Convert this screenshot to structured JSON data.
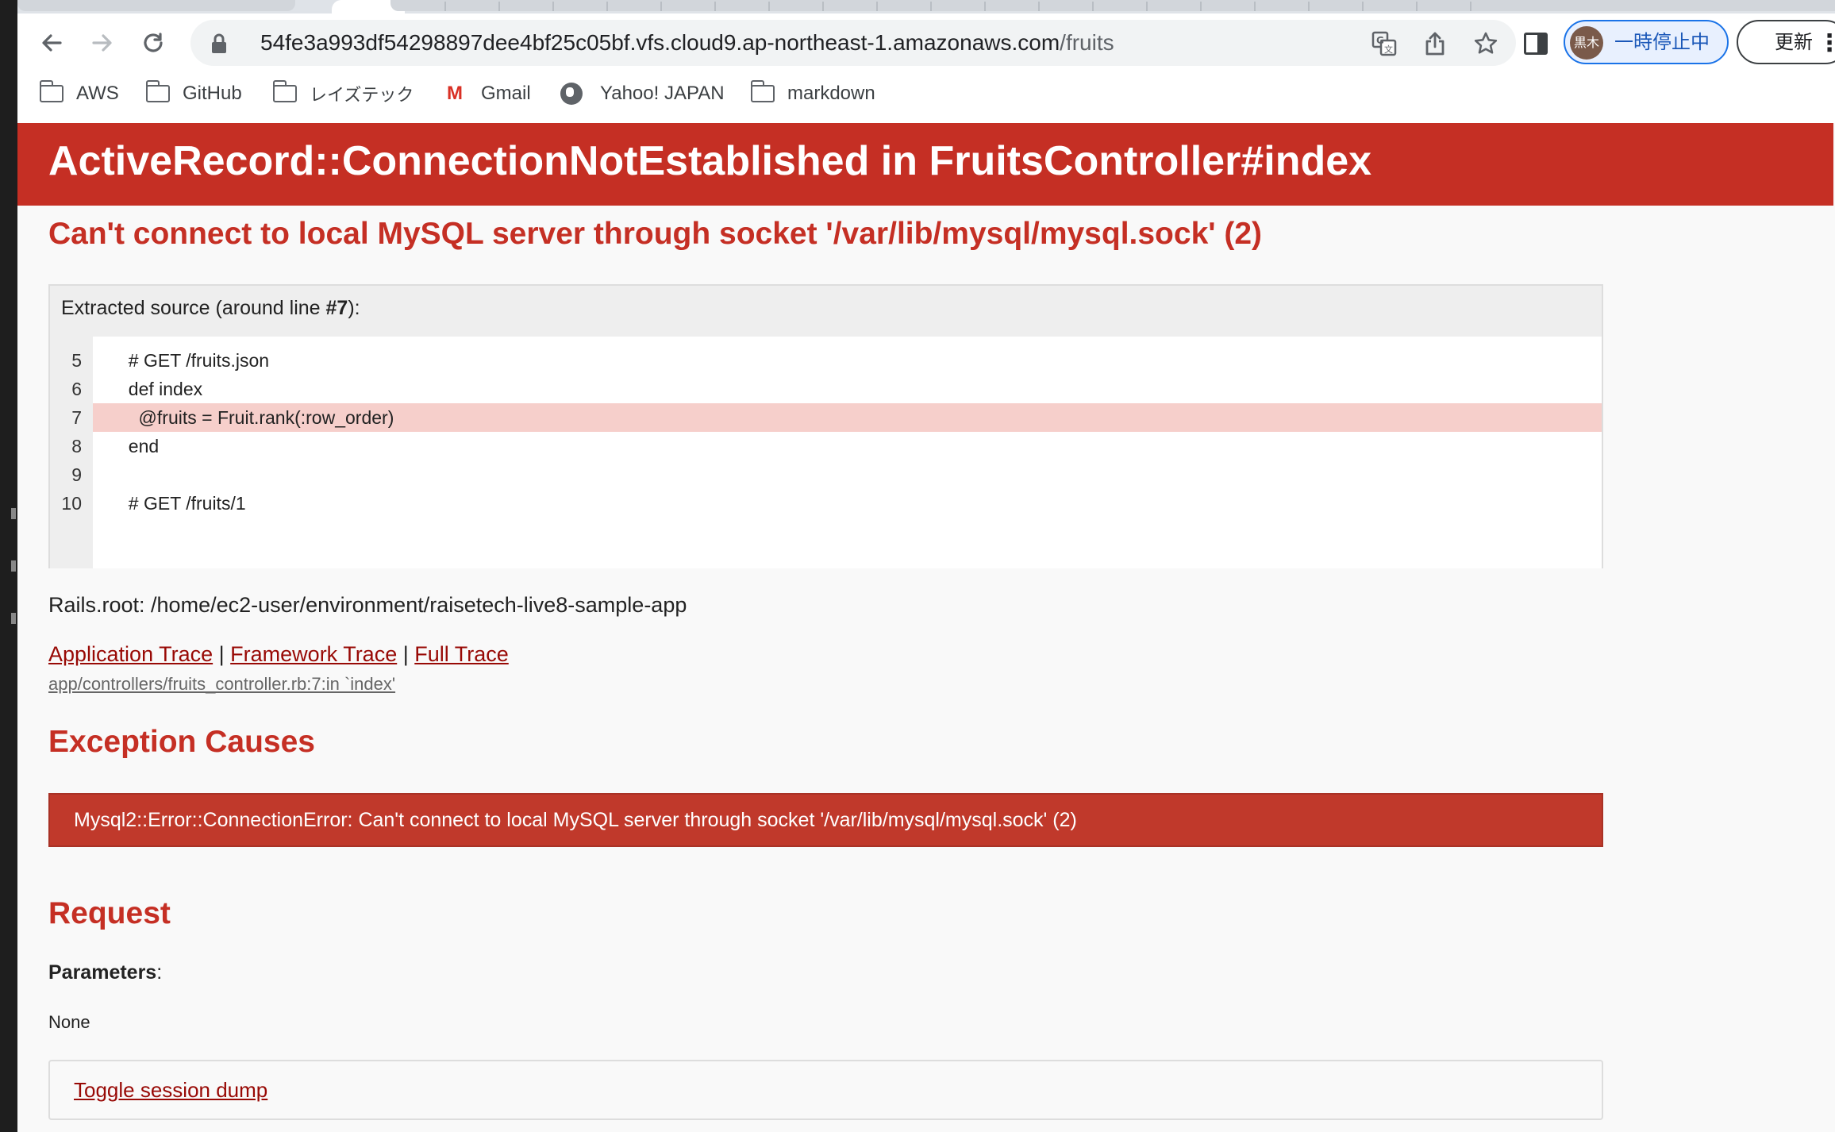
{
  "browser": {
    "url_host": "54fe3a993df54298897dee4bf25c05bf.vfs.cloud9.ap-northeast-1.amazonaws.com",
    "url_path": "/fruits",
    "profile_avatar_text": "黒木",
    "profile_status": "一時停止中",
    "update_label": "更新",
    "icons": {
      "back": "arrow-left-icon",
      "forward": "arrow-right-icon",
      "reload": "reload-icon",
      "lock": "lock-icon",
      "translate": "translate-icon",
      "share": "share-icon",
      "bookmark": "star-icon",
      "side_panel": "side-panel-icon",
      "menu": "kebab-menu-icon"
    }
  },
  "bookmarks": [
    {
      "label": "AWS",
      "icon": "folder-icon"
    },
    {
      "label": "GitHub",
      "icon": "folder-icon"
    },
    {
      "label": "レイズテック",
      "icon": "folder-icon"
    },
    {
      "label": "Gmail",
      "icon": "gmail-icon"
    },
    {
      "label": "Yahoo! JAPAN",
      "icon": "globe-icon"
    },
    {
      "label": "markdown",
      "icon": "folder-icon"
    }
  ],
  "error": {
    "title": "ActiveRecord::ConnectionNotEstablished in FruitsController#index",
    "message": "Can't connect to local MySQL server through socket '/var/lib/mysql/mysql.sock' (2)",
    "source_heading_prefix": "Extracted source (around line ",
    "source_heading_line": "#7",
    "source_heading_suffix": "):",
    "source_lines": [
      {
        "num": "5",
        "code": "  # GET /fruits.json"
      },
      {
        "num": "6",
        "code": "  def index"
      },
      {
        "num": "7",
        "code": "    @fruits = Fruit.rank(:row_order)",
        "highlighted": true
      },
      {
        "num": "8",
        "code": "  end"
      },
      {
        "num": "9",
        "code": ""
      },
      {
        "num": "10",
        "code": "  # GET /fruits/1"
      }
    ],
    "rails_root": "Rails.root: /home/ec2-user/environment/raisetech-live8-sample-app",
    "trace_links": {
      "application": "Application Trace",
      "framework": "Framework Trace",
      "full": "Full Trace",
      "separator": "|"
    },
    "trace_line": "app/controllers/fruits_controller.rb:7:in `index'",
    "exception_causes_title": "Exception Causes",
    "cause": "Mysql2::Error::ConnectionError: Can't connect to local MySQL server through socket '/var/lib/mysql/mysql.sock' (2)",
    "request_title": "Request",
    "parameters_label": "Parameters",
    "parameters_colon": ":",
    "parameters_value": "None",
    "toggle_session": "Toggle session dump"
  },
  "colors": {
    "header_red": "#c52f24",
    "cause_red": "#c0392b",
    "highlight_line": "#f6cfcb",
    "link": "#980905"
  }
}
